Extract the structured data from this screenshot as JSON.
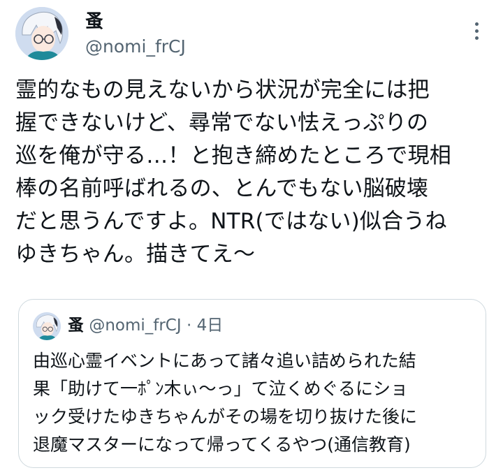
{
  "tweet": {
    "author": {
      "display_name": "蚤",
      "handle": "@nomi_frCJ",
      "avatar_icon": "avatar-icon"
    },
    "more_icon": "more-options-icon",
    "text_lines": [
      "霊的なもの見えないから状況が完全には把",
      "握できないけど、尋常でない怯えっぷりの",
      "巡を俺が守る…！と抱き締めたところで現相",
      "棒の名前呼ばれるの、とんでもない脳破壊",
      "だと思うんですよ。NTR(ではない)似合うね",
      "ゆきちゃん。描きてえ〜"
    ]
  },
  "quoted_tweet": {
    "author": {
      "display_name": "蚤",
      "handle": "@nomi_frCJ"
    },
    "separator": "·",
    "time": "4日",
    "text_lines": [
      "由巡心霊イベントにあって諸々追い詰められた結",
      "果「助けて一ﾎﾟﾝ木ぃ〜っ」て泣くめぐるにショ",
      "ック受けたゆきちゃんがその場を切り抜けた後に",
      "退魔マスターになって帰ってくるやつ(通信教育)"
    ]
  },
  "colors": {
    "text_primary": "#0f1419",
    "text_secondary": "#536471",
    "border": "#cfd9de",
    "background": "#ffffff"
  }
}
